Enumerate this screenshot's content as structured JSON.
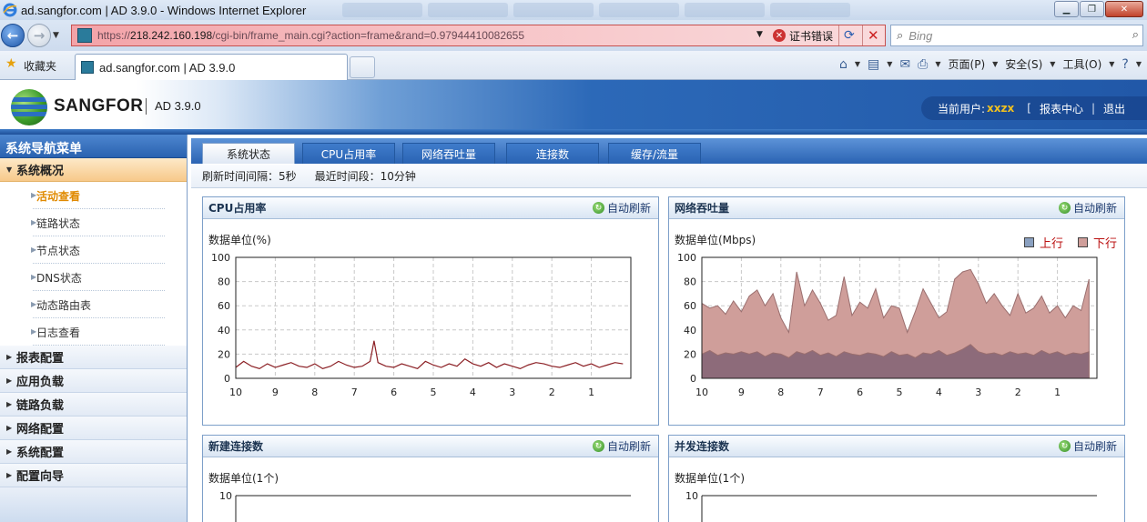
{
  "browser": {
    "window_title": "ad.sangfor.com | AD 3.9.0 - Windows Internet Explorer",
    "url_prefix": "https://",
    "url_host": "218.242.160.198",
    "url_path": "/cgi-bin/frame_main.cgi?action=frame&rand=0.97944410082655",
    "cert_error": "证书错误",
    "search_placeholder": "Bing",
    "favorites_label": "收藏夹",
    "tab_title": "ad.sangfor.com | AD 3.9.0",
    "menu": {
      "page": "页面(P)",
      "safety": "安全(S)",
      "tools": "工具(O)"
    }
  },
  "app": {
    "logo_text": "SANGFOR",
    "version": "AD 3.9.0",
    "current_user_label": "当前用户:",
    "current_user": "xxzx",
    "report_center": "报表中心",
    "logout": "退出"
  },
  "sidebar": {
    "title": "系统导航菜单",
    "active_group": "系统概况",
    "sub_items": [
      {
        "label": "活动查看",
        "current": true
      },
      {
        "label": "链路状态",
        "current": false
      },
      {
        "label": "节点状态",
        "current": false
      },
      {
        "label": "DNS状态",
        "current": false
      },
      {
        "label": "动态路由表",
        "current": false
      },
      {
        "label": "日志查看",
        "current": false
      }
    ],
    "groups": [
      "报表配置",
      "应用负载",
      "链路负载",
      "网络配置",
      "系统配置",
      "配置向导"
    ]
  },
  "tabs": [
    "系统状态",
    "CPU占用率",
    "网络吞吐量",
    "连接数",
    "缓存/流量"
  ],
  "active_tab": 0,
  "info": {
    "refresh_interval": "刷新时间间隔：5秒",
    "recent_period": "最近时间段：10分钟"
  },
  "panels": {
    "auto_refresh": "自动刷新",
    "cpu": {
      "title": "CPU占用率",
      "unit": "数据单位(%)"
    },
    "net": {
      "title": "网络吞吐量",
      "unit": "数据单位(Mbps)",
      "legend_up": "上行",
      "legend_down": "下行"
    },
    "newconn": {
      "title": "新建连接数",
      "unit": "数据单位(1个)",
      "ytop": "10"
    },
    "concurrent": {
      "title": "并发连接数",
      "unit": "数据单位(1个)",
      "ytop": "10"
    }
  },
  "chart_data": [
    {
      "type": "line",
      "title": "CPU占用率",
      "ylabel": "数据单位(%)",
      "x_ticks": [
        "10",
        "9",
        "8",
        "7",
        "6",
        "5",
        "4",
        "3",
        "2",
        "1"
      ],
      "y_ticks": [
        "0",
        "20",
        "40",
        "60",
        "80",
        "100"
      ],
      "ylim": [
        0,
        100
      ],
      "xlim": [
        10,
        0
      ],
      "grid": true,
      "color": "#8b1f24",
      "series": [
        {
          "x": [
            10,
            9.8,
            9.6,
            9.4,
            9.2,
            9,
            8.8,
            8.6,
            8.4,
            8.2,
            8,
            7.8,
            7.6,
            7.4,
            7.2,
            7,
            6.8,
            6.6,
            6.5,
            6.4,
            6.2,
            6,
            5.8,
            5.6,
            5.4,
            5.2,
            5,
            4.8,
            4.6,
            4.4,
            4.2,
            4,
            3.8,
            3.6,
            3.4,
            3.2,
            3,
            2.8,
            2.6,
            2.4,
            2.2,
            2,
            1.8,
            1.6,
            1.4,
            1.2,
            1,
            0.8,
            0.6,
            0.4,
            0.2
          ],
          "values": [
            9,
            14,
            10,
            8,
            12,
            9,
            11,
            13,
            10,
            9,
            12,
            8,
            10,
            14,
            11,
            9,
            10,
            14,
            31,
            13,
            10,
            9,
            12,
            10,
            8,
            14,
            11,
            9,
            12,
            10,
            16,
            12,
            10,
            13,
            9,
            12,
            10,
            8,
            11,
            13,
            12,
            10,
            9,
            11,
            13,
            10,
            12,
            9,
            11,
            13,
            12
          ]
        }
      ]
    },
    {
      "type": "area",
      "title": "网络吞吐量",
      "ylabel": "数据单位(Mbps)",
      "x_ticks": [
        "10",
        "9",
        "8",
        "7",
        "6",
        "5",
        "4",
        "3",
        "2",
        "1"
      ],
      "y_ticks": [
        "0",
        "20",
        "40",
        "60",
        "80",
        "100"
      ],
      "ylim": [
        0,
        100
      ],
      "xlim": [
        10,
        0
      ],
      "grid": true,
      "legend": "top-right",
      "series": [
        {
          "name": "下行",
          "color": "#cf9e9a",
          "x": [
            10,
            9.8,
            9.6,
            9.4,
            9.2,
            9,
            8.8,
            8.6,
            8.4,
            8.2,
            8,
            7.8,
            7.6,
            7.4,
            7.2,
            7,
            6.8,
            6.6,
            6.4,
            6.2,
            6,
            5.8,
            5.6,
            5.4,
            5.2,
            5,
            4.8,
            4.6,
            4.4,
            4.2,
            4,
            3.8,
            3.6,
            3.4,
            3.2,
            3,
            2.8,
            2.6,
            2.4,
            2.2,
            2,
            1.8,
            1.6,
            1.4,
            1.2,
            1,
            0.8,
            0.6,
            0.4,
            0.2
          ],
          "values": [
            62,
            58,
            60,
            53,
            64,
            55,
            68,
            73,
            60,
            70,
            50,
            38,
            88,
            60,
            73,
            62,
            48,
            52,
            84,
            52,
            63,
            58,
            74,
            50,
            60,
            58,
            38,
            55,
            74,
            62,
            50,
            55,
            82,
            88,
            90,
            78,
            62,
            70,
            60,
            52,
            70,
            54,
            58,
            68,
            54,
            60,
            50,
            60,
            56,
            82
          ]
        },
        {
          "name": "上行",
          "color": "#8d6b7a",
          "x": [
            10,
            9.8,
            9.6,
            9.4,
            9.2,
            9,
            8.8,
            8.6,
            8.4,
            8.2,
            8,
            7.8,
            7.6,
            7.4,
            7.2,
            7,
            6.8,
            6.6,
            6.4,
            6.2,
            6,
            5.8,
            5.6,
            5.4,
            5.2,
            5,
            4.8,
            4.6,
            4.4,
            4.2,
            4,
            3.8,
            3.6,
            3.4,
            3.2,
            3,
            2.8,
            2.6,
            2.4,
            2.2,
            2,
            1.8,
            1.6,
            1.4,
            1.2,
            1,
            0.8,
            0.6,
            0.4,
            0.2
          ],
          "values": [
            20,
            23,
            19,
            21,
            20,
            22,
            20,
            22,
            18,
            21,
            20,
            17,
            22,
            20,
            23,
            19,
            21,
            18,
            22,
            20,
            19,
            21,
            20,
            18,
            22,
            19,
            20,
            17,
            21,
            20,
            23,
            19,
            21,
            24,
            28,
            22,
            20,
            21,
            19,
            22,
            20,
            21,
            19,
            23,
            20,
            22,
            19,
            21,
            20,
            22
          ]
        }
      ]
    }
  ]
}
